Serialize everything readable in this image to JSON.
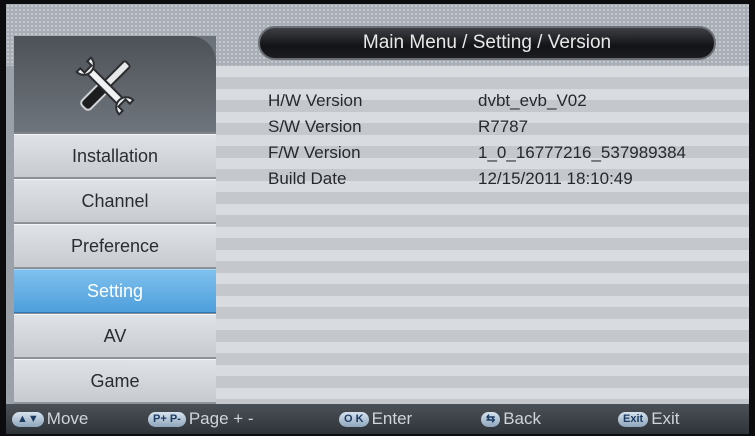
{
  "header": {
    "title": "Main Menu / Setting / Version"
  },
  "sidebar": {
    "logo_icon": "tools-icon",
    "items": [
      {
        "label": "Installation",
        "selected": false
      },
      {
        "label": "Channel",
        "selected": false
      },
      {
        "label": "Preference",
        "selected": false
      },
      {
        "label": "Setting",
        "selected": true
      },
      {
        "label": "AV",
        "selected": false
      },
      {
        "label": "Game",
        "selected": false
      }
    ]
  },
  "version_info": [
    {
      "label": "H/W Version",
      "value": "dvbt_evb_V02"
    },
    {
      "label": "S/W Version",
      "value": "R7787"
    },
    {
      "label": "F/W Version",
      "value": "1_0_16777216_537989384"
    },
    {
      "label": "Build Date",
      "value": "12/15/2011 18:10:49"
    }
  ],
  "footer": {
    "hints": [
      {
        "key": "▲▼",
        "label": "Move"
      },
      {
        "key": "P+ P-",
        "label": "Page + -"
      },
      {
        "key": "O K",
        "label": "Enter"
      },
      {
        "key": "⇆",
        "label": "Back"
      },
      {
        "key": "Exit",
        "label": "Exit"
      }
    ]
  },
  "colors": {
    "selected": "#5aa9e2",
    "background": "#0c0c0e"
  }
}
